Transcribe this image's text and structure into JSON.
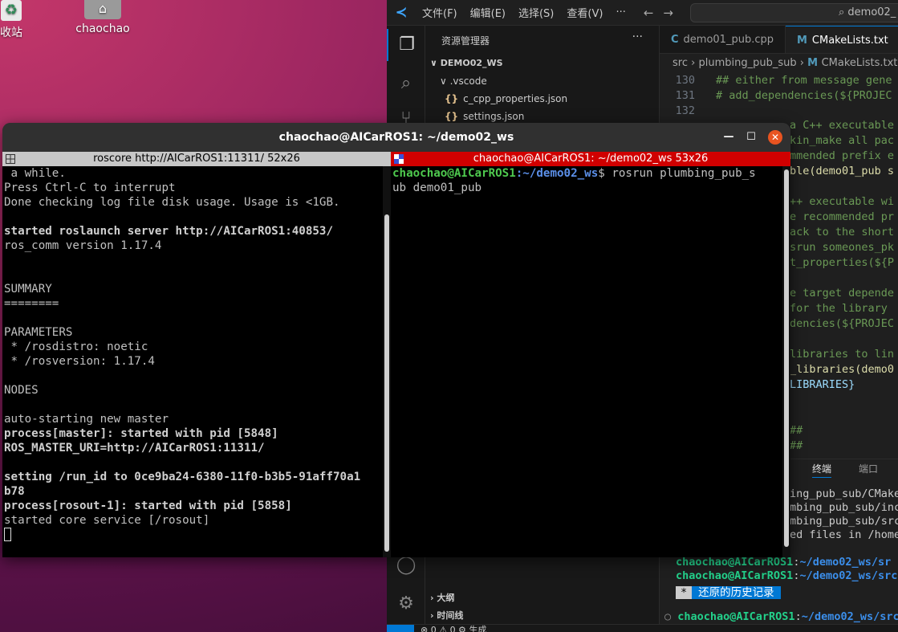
{
  "desktop": {
    "icons": [
      {
        "label": "收站",
        "icon": "trash-icon"
      },
      {
        "label": "chaochao",
        "icon": "home-folder-icon"
      }
    ]
  },
  "vscode": {
    "menus": [
      "文件(F)",
      "编辑(E)",
      "选择(S)",
      "查看(V)",
      "···"
    ],
    "search_text": "demo02_",
    "explorer": {
      "title": "资源管理器",
      "more": "···",
      "workspace": "DEMO02_WS",
      "items": [
        {
          "label": ".vscode",
          "type": "folder"
        },
        {
          "label": "c_cpp_properties.json",
          "type": "json"
        },
        {
          "label": "settings.json",
          "type": "json"
        }
      ],
      "outline": "大纲",
      "timeline": "时间线"
    },
    "tabs": [
      {
        "label": "demo01_pub.cpp",
        "icon": "C",
        "active": false
      },
      {
        "label": "CMakeLists.txt",
        "icon": "M",
        "active": true
      }
    ],
    "breadcrumb": [
      "src",
      "plumbing_pub_sub",
      "CMakeLists.txt"
    ],
    "editor_lines": [
      {
        "num": "130",
        "text": "## either from message gene"
      },
      {
        "num": "131",
        "text": "# add_dependencies(${PROJEC"
      },
      {
        "num": "132",
        "text": ""
      }
    ],
    "editor_visible_fragments": [
      "a C++ executable",
      "kin_make all pac",
      "mmended prefix e",
      "ble(demo01_pub s",
      "++ executable wi",
      "e recommended pr",
      "ack to the short",
      "srun someones_pk",
      "t_properties(${P",
      "e target depende",
      "for the library",
      "dencies(${PROJEC",
      "libraries to lin",
      "_libraries(demo0",
      "LIBRARIES}",
      "##",
      "##"
    ],
    "panel_tabs": [
      "终端",
      "端口"
    ],
    "panel_fragments": [
      "ing_pub_sub/CMake",
      "mbing_pub_sub/inc",
      "mbing_pub_sub/src",
      "ed files in /home"
    ],
    "terminal_lines": [
      {
        "user": "chaochao@AICarROS1",
        "path": "~/demo02_ws/sr"
      },
      {
        "user": "chaochao@AICarROS1",
        "path": "~/demo02_ws/src$"
      }
    ],
    "history_badge": "还原的历史记录",
    "history_star": "*",
    "last_prompt": {
      "user": "chaochao@AICarROS1",
      "path": "~/demo02_ws/src$"
    },
    "status": "⊗ 0 ⚠ 0   ⚙ 生成"
  },
  "terminal": {
    "title": "chaochao@AICarROS1: ~/demo02_ws",
    "left_pane": {
      "title": "roscore http://AICarROS1:11311/ 52x26",
      "lines": [
        {
          "text": " a while.",
          "bold": false
        },
        {
          "text": "Press Ctrl-C to interrupt",
          "bold": false
        },
        {
          "text": "Done checking log file disk usage. Usage is <1GB.",
          "bold": false
        },
        {
          "text": "",
          "bold": false
        },
        {
          "text": "started roslaunch server http://AICarROS1:40853/",
          "bold": true
        },
        {
          "text": "ros_comm version 1.17.4",
          "bold": false
        },
        {
          "text": "",
          "bold": false
        },
        {
          "text": "",
          "bold": false
        },
        {
          "text": "SUMMARY",
          "bold": false
        },
        {
          "text": "========",
          "bold": false
        },
        {
          "text": "",
          "bold": false
        },
        {
          "text": "PARAMETERS",
          "bold": false
        },
        {
          "text": " * /rosdistro: noetic",
          "bold": false
        },
        {
          "text": " * /rosversion: 1.17.4",
          "bold": false
        },
        {
          "text": "",
          "bold": false
        },
        {
          "text": "NODES",
          "bold": false
        },
        {
          "text": "",
          "bold": false
        },
        {
          "text": "auto-starting new master",
          "bold": false
        },
        {
          "text": "process[master]: started with pid [5848]",
          "bold": true
        },
        {
          "text": "ROS_MASTER_URI=http://AICarROS1:11311/",
          "bold": true
        },
        {
          "text": "",
          "bold": false
        },
        {
          "text": "setting /run_id to 0ce9ba24-6380-11f0-b3b5-91aff70a1",
          "bold": true
        },
        {
          "text": "b78",
          "bold": true
        },
        {
          "text": "process[rosout-1]: started with pid [5858]",
          "bold": true
        },
        {
          "text": "started core service [/rosout]",
          "bold": false
        }
      ]
    },
    "right_pane": {
      "title": "chaochao@AICarROS1: ~/demo02_ws 53x26",
      "prompt_user": "chaochao@AICarROS1",
      "prompt_path": ":~/demo02_ws",
      "command": "$ rosrun plumbing_pub_s",
      "command_cont": "ub demo01_pub"
    }
  }
}
